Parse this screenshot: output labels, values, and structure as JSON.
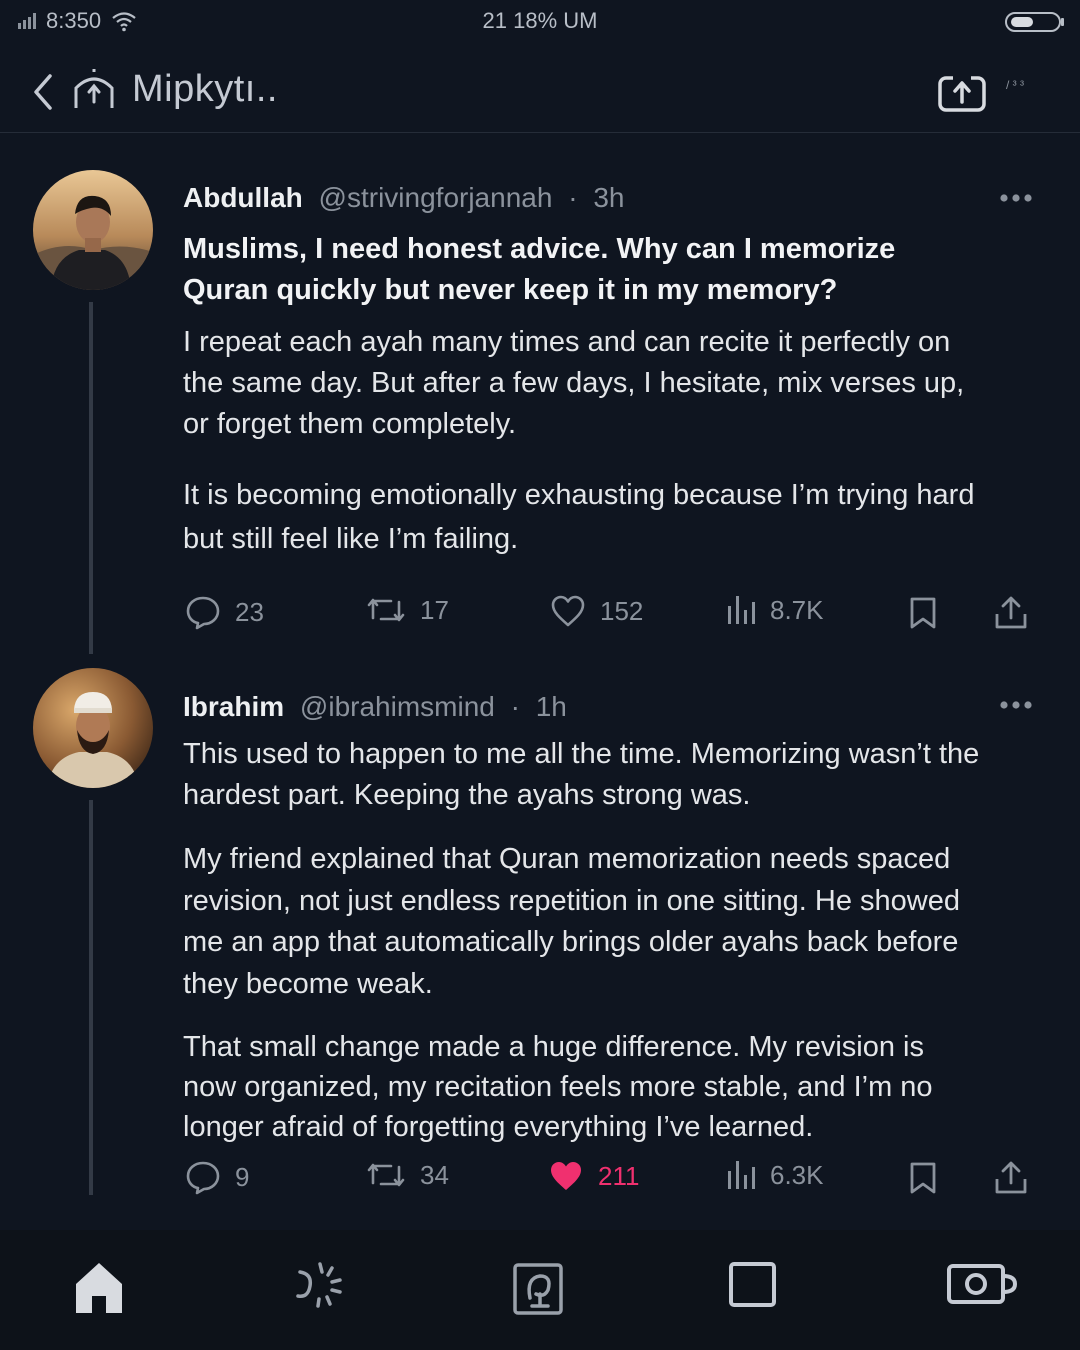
{
  "status_bar": {
    "left_text": "8:350",
    "center_text": "21 18% UM"
  },
  "header": {
    "title": "Mipkytı..",
    "count_text": "/ ³ ³"
  },
  "posts": [
    {
      "author": "Abdullah",
      "handle": "@strivingforjannah",
      "time": "3h",
      "title": "Muslims, I need honest advice. Why can I memorize Quran quickly but never keep it in my memory?",
      "paragraphs": [
        "I repeat each ayah many times and can recite it perfectly on the same day. But after a few days, I hesitate, mix verses up, or forget them completely.",
        "It is becoming emotionally exhausting because I’m trying hard but still feel like I’m failing."
      ],
      "stats": {
        "replies": "23",
        "reposts": "17",
        "likes": "152",
        "views": "8.7K"
      },
      "liked": false
    },
    {
      "author": "Ibrahim",
      "handle": "@ibrahimsmind",
      "time": "1h",
      "paragraphs": [
        "This used to happen to me all the time. Memorizing wasn’t the hardest part. Keeping the ayahs strong was.",
        "My friend explained that Quran memorization needs spaced revision, not just endless repetition in one sitting. He showed me an app that automatically brings older ayahs back before they become weak.",
        "That small change made a huge difference. My revision is now organized, my recitation feels more stable, and I’m no longer afraid of forgetting everything I’ve learned."
      ],
      "stats": {
        "replies": "9",
        "reposts": "34",
        "likes": "211",
        "views": "6.3K"
      },
      "liked": true
    }
  ],
  "icons": {
    "statusbar": [
      "signal-icon",
      "wifi-icon",
      "battery-icon"
    ],
    "header": [
      "back-arrow-icon",
      "mosque-logo-icon",
      "share-box-icon"
    ],
    "actions": [
      "reply-icon",
      "repost-icon",
      "like-icon",
      "views-icon",
      "bookmark-icon",
      "share-icon"
    ],
    "tabs": [
      "home-icon",
      "spark-icon",
      "quran-note-icon",
      "square-icon",
      "camera-icon"
    ]
  },
  "colors": {
    "background": "#0f1520",
    "like_active": "#f0306f",
    "muted": "#8b929c",
    "text": "#e7e9ea"
  }
}
